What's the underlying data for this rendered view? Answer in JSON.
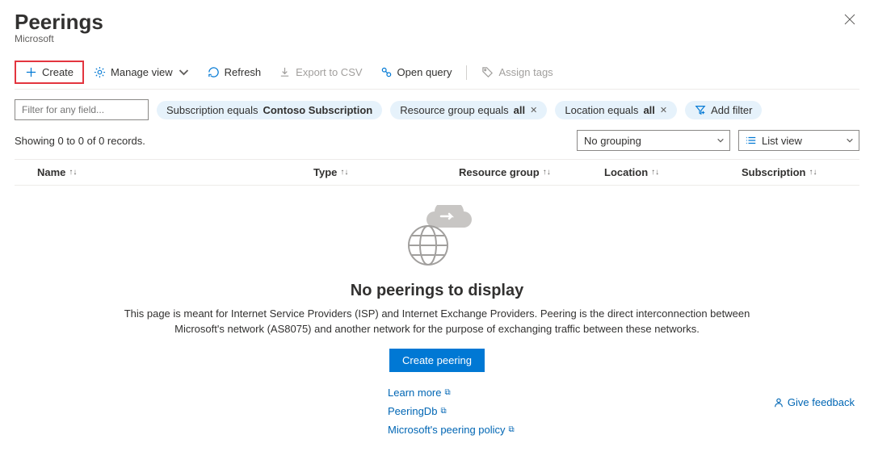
{
  "header": {
    "title": "Peerings",
    "subtitle": "Microsoft"
  },
  "toolbar": {
    "create": "Create",
    "manage_view": "Manage view",
    "refresh": "Refresh",
    "export_csv": "Export to CSV",
    "open_query": "Open query",
    "assign_tags": "Assign tags"
  },
  "filters": {
    "placeholder": "Filter for any field...",
    "subscription_label": "Subscription equals ",
    "subscription_value": "Contoso Subscription",
    "rg_label": "Resource group equals ",
    "rg_value": "all",
    "loc_label": "Location equals ",
    "loc_value": "all",
    "add_filter": "Add filter"
  },
  "list": {
    "records": "Showing 0 to 0 of 0 records.",
    "grouping": "No grouping",
    "view": "List view"
  },
  "columns": {
    "name": "Name",
    "type": "Type",
    "rg": "Resource group",
    "location": "Location",
    "subscription": "Subscription"
  },
  "empty": {
    "title": "No peerings to display",
    "desc": "This page is meant for Internet Service Providers (ISP) and Internet Exchange Providers. Peering is the direct interconnection between Microsoft's network (AS8075) and another network for the purpose of exchanging traffic between these networks.",
    "create_btn": "Create peering",
    "learn_more": "Learn more",
    "peeringdb": "PeeringDb",
    "policy": "Microsoft's peering policy",
    "feedback": "Give feedback"
  }
}
